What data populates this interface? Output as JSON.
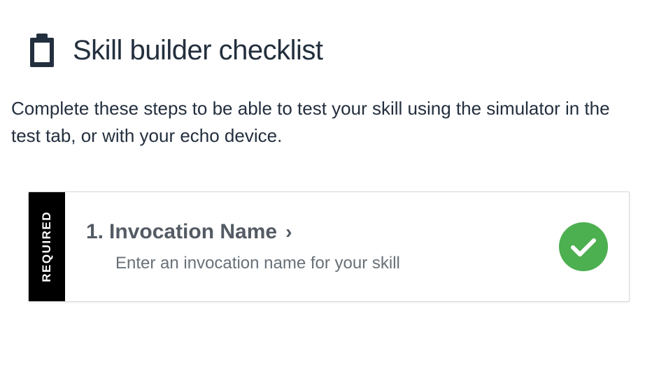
{
  "header": {
    "title": "Skill builder checklist"
  },
  "description": "Complete these steps to be able to test your skill using the simulator in the test tab, or with your echo device.",
  "checklist": {
    "items": [
      {
        "badge": "REQUIRED",
        "number": "1.",
        "title": "Invocation Name",
        "subtitle": "Enter an invocation name for your skill",
        "status": "complete"
      }
    ]
  }
}
